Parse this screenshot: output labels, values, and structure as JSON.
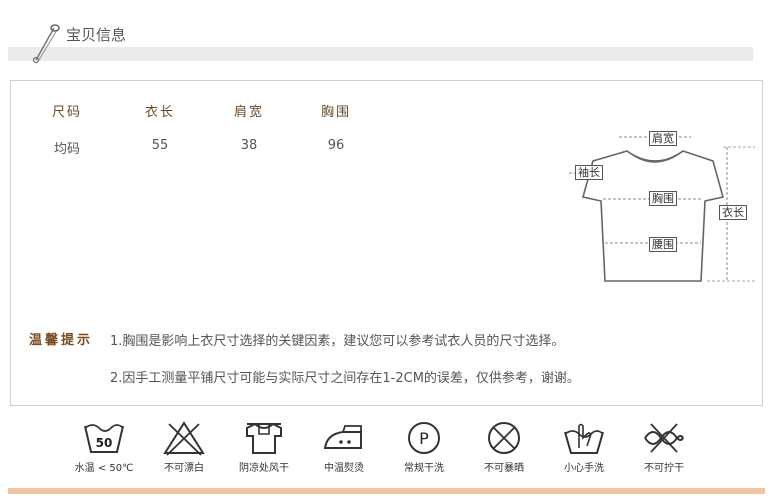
{
  "header": {
    "title": "宝贝信息"
  },
  "size_table": {
    "columns": [
      "尺码",
      "衣长",
      "肩宽",
      "胸围"
    ],
    "rows": [
      [
        "均码",
        "55",
        "38",
        "96"
      ]
    ]
  },
  "diagram": {
    "shoulder": "肩宽",
    "sleeve": "袖长",
    "chest": "胸围",
    "length": "衣长",
    "waist": "腰围"
  },
  "tips": {
    "title": "温馨提示",
    "line1": "1.胸围是影响上衣尺寸选择的关键因素，建议您可以参考试衣人员的尺寸选择。",
    "line2": "2.因手工测量平铺尺寸可能与实际尺寸之间存在1-2CM的误差，仅供参考，谢谢。"
  },
  "care": {
    "wash_temp_number": "50",
    "items": [
      "水温 < 50℃",
      "不可漂白",
      "阴凉处风干",
      "中温熨烫",
      "常规干洗",
      "不可暴晒",
      "小心手洗",
      "不可拧干"
    ],
    "dryclean_letter": "P"
  },
  "colors": {
    "accent_brown": "#7a4a22",
    "bottom_bar": "#f2c4a4"
  }
}
